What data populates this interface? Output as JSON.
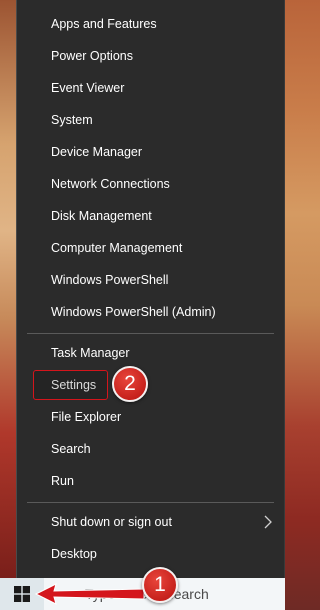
{
  "menu": {
    "group1": [
      "Apps and Features",
      "Power Options",
      "Event Viewer",
      "System",
      "Device Manager",
      "Network Connections",
      "Disk Management",
      "Computer Management",
      "Windows PowerShell",
      "Windows PowerShell (Admin)"
    ],
    "group2": [
      "Task Manager",
      "Settings",
      "File Explorer",
      "Search",
      "Run"
    ],
    "group3": [
      "Shut down or sign out",
      "Desktop"
    ]
  },
  "annotations": {
    "step1": "1",
    "step2": "2"
  },
  "taskbar": {
    "search_placeholder": "Type here to search"
  },
  "colors": {
    "highlight": "#d4151c",
    "menu_bg": "#2b2b2b",
    "badge": "#c8201a"
  }
}
